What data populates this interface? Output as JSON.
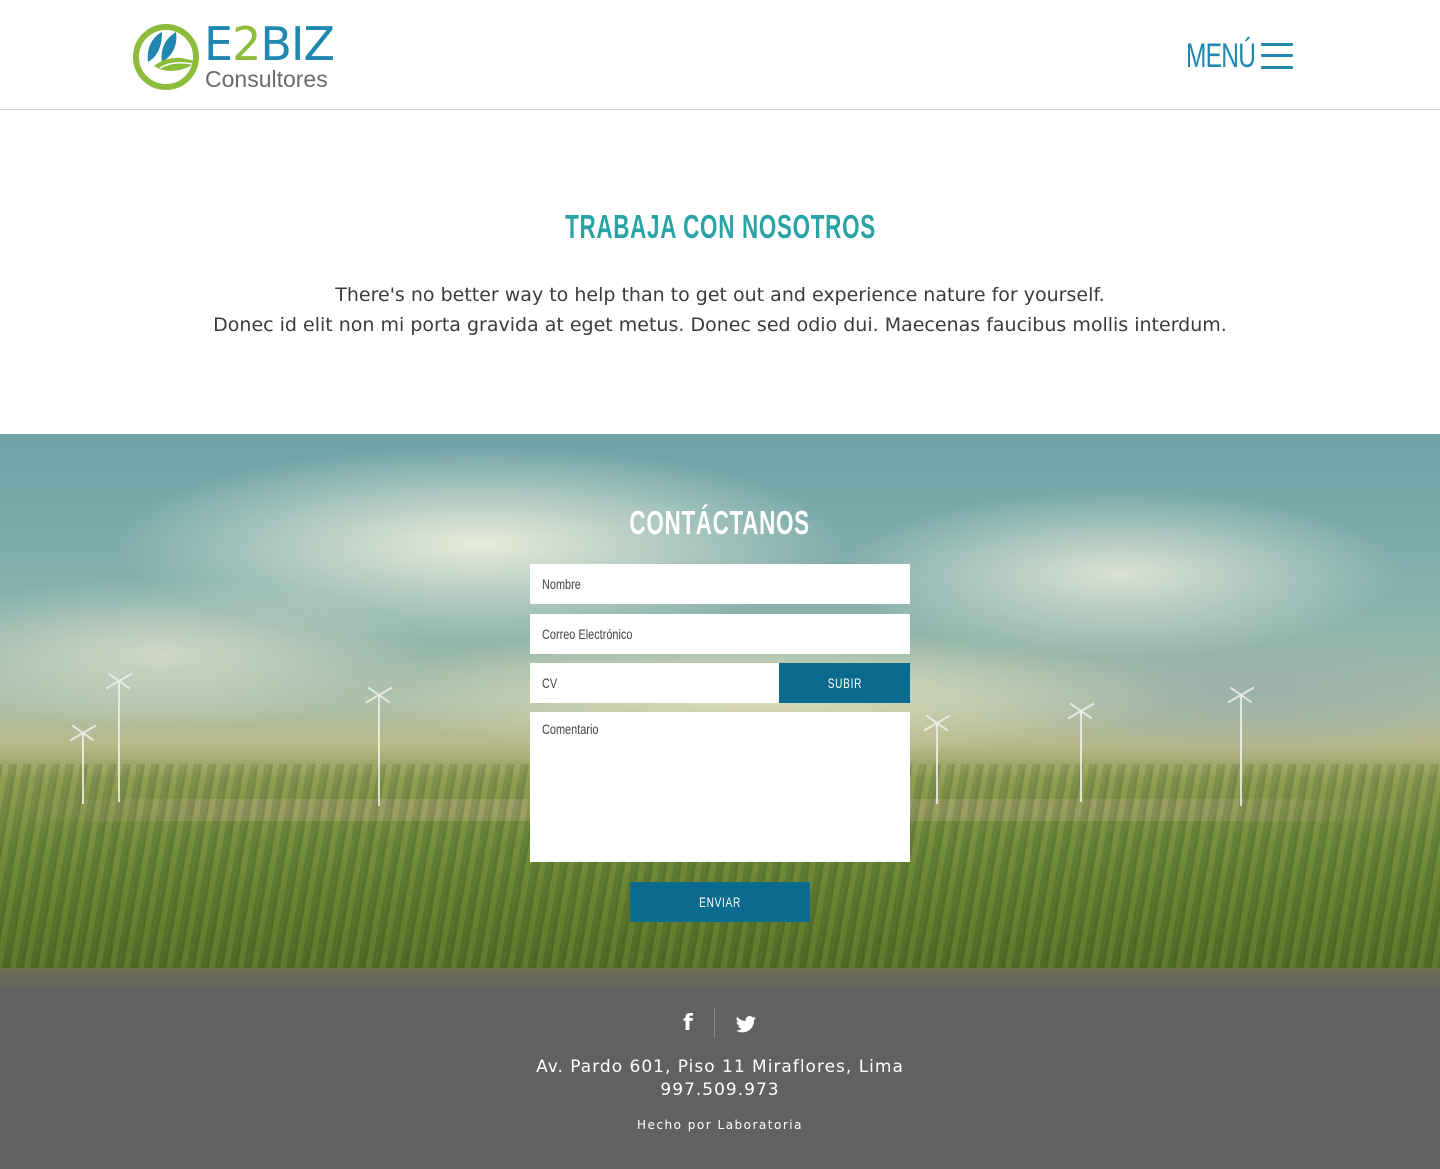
{
  "header": {
    "logo_brand_prefix": "E",
    "logo_brand_digit": "2",
    "logo_brand_suffix": "BIZ",
    "logo_tagline": "Consultores",
    "menu_label": "Menú"
  },
  "intro": {
    "title": "Trabaja con nosotros",
    "line1": "There's no better way to help than to get out and experience nature for yourself.",
    "line2": "Donec id elit non mi porta gravida at eget metus. Donec sed odio dui. Maecenas faucibus mollis interdum."
  },
  "contact": {
    "title": "Contáctanos",
    "name_placeholder": "Nombre",
    "email_placeholder": "Correo Electrónico",
    "cv_placeholder": "CV",
    "upload_label": "Subir",
    "comment_placeholder": "Comentario",
    "submit_label": "Enviar"
  },
  "footer": {
    "social": [
      "facebook-icon",
      "twitter-icon"
    ],
    "address": "Av. Pardo 601, Piso 11 Miraflores, Lima",
    "phone": "997.509.973",
    "credit": "Hecho por Laboratoria"
  },
  "colors": {
    "brand_blue": "#1f87b0",
    "brand_green": "#8dbb3a",
    "title_teal": "#2aa3a6",
    "button_blue": "#0b6b8e",
    "footer_gray": "#616161"
  }
}
